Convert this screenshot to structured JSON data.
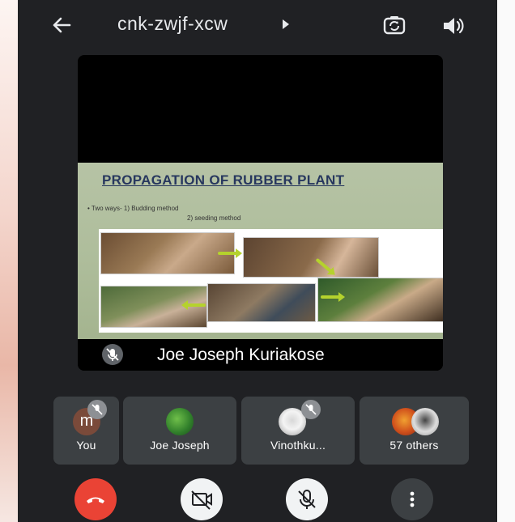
{
  "meeting": {
    "code": "cnk-zwjf-xcw"
  },
  "slide": {
    "title": "PROPAGATION OF RUBBER PLANT",
    "bullet_line1": "• Two ways-  1) Budding method",
    "bullet_line2": "2) seeding method"
  },
  "main_speaker": {
    "name": "Joe Joseph Kuriakose"
  },
  "participants": [
    {
      "label": "You",
      "initial": "m"
    },
    {
      "label": "Joe Joseph"
    },
    {
      "label": "Vinothku..."
    },
    {
      "label": "57 others"
    }
  ],
  "colors": {
    "end_call": "#ea4335",
    "background": "#202124",
    "tile": "#3c4043"
  }
}
